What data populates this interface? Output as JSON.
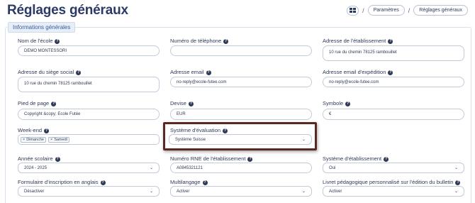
{
  "header": {
    "title": "Réglages généraux",
    "breadcrumbs": [
      "Paramètres",
      "Réglages généraux"
    ],
    "separator": "/"
  },
  "panel": {
    "title": "Informations générales"
  },
  "help_glyph": "?",
  "chevron": "⌄",
  "fields": {
    "school_name": {
      "label": "Nom de l'école",
      "value": "DEMO MONTESSORI"
    },
    "phone": {
      "label": "Numéro de téléphone",
      "value": ""
    },
    "school_address": {
      "label": "Adresse de l'établissement",
      "value": "10 rue du chemin 78125 rambouillet"
    },
    "hq_address": {
      "label": "Adresse du siège social",
      "value": "10 rue du chemin 78125 rambouillet"
    },
    "email": {
      "label": "Adresse email",
      "value": "no-reply@ecole-futee.com"
    },
    "sender_email": {
      "label": "Adresse email d'expédition",
      "value": "no-reply@ecole-futee.com"
    },
    "footer": {
      "label": "Pied de page",
      "value": "Copyright &copy; Ecole Futée"
    },
    "currency": {
      "label": "Devise",
      "value": "EUR"
    },
    "symbol": {
      "label": "Symbole",
      "value": "€"
    },
    "weekend": {
      "label": "Week-end",
      "tags": [
        "Dimanche",
        "Samedi"
      ],
      "remove_glyph": "×"
    },
    "evaluation_system": {
      "label": "Système d'évaluation",
      "value": "Système Suisse"
    },
    "school_year": {
      "label": "Année scolaire",
      "value": "2024 - 2025"
    },
    "rne_number": {
      "label": "Numéro RNE de l'établissement",
      "value": "A0845321121"
    },
    "school_system": {
      "label": "Système d'établissement",
      "value": "Oui"
    },
    "english_form": {
      "label": "Formulaire d'inscription en anglais",
      "value": "Désactiver"
    },
    "multilanguage": {
      "label": "Multilangage",
      "value": "Activer"
    },
    "custom_booklet": {
      "label": "Livret pédagogique personnalisé sur l'édition du bulletin",
      "value": "Activer"
    }
  }
}
